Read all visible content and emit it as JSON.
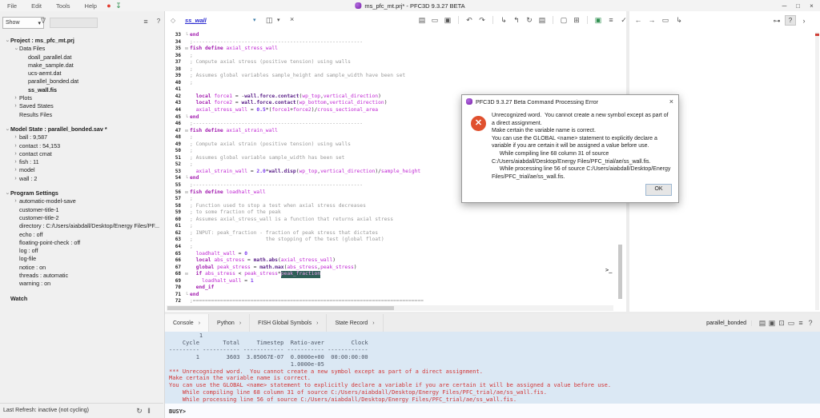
{
  "titlebar": {
    "menus": [
      "File",
      "Edit",
      "Tools",
      "Help"
    ],
    "left_icons": [
      {
        "name": "record-icon",
        "glyph": "●",
        "color": "#e23b2e"
      },
      {
        "name": "download-icon",
        "glyph": "↧",
        "color": "#2f8f4f"
      }
    ],
    "title": "ms_pfc_mt.prj* - PFC3D 9.3.27 BETA",
    "window_buttons": [
      {
        "name": "minimize-button",
        "glyph": "─"
      },
      {
        "name": "maximize-button",
        "glyph": "□"
      },
      {
        "name": "close-button",
        "glyph": "×"
      }
    ]
  },
  "left_panel": {
    "show_label": "Show",
    "combo_caret": "▾",
    "funnel_glyph": "∇",
    "options_glyph": "≡",
    "help_glyph": "?",
    "search_value": "",
    "tree": [
      {
        "t": "Project :  ms_pfc_mt.prj",
        "lv": 0,
        "bold": true,
        "ar": "e"
      },
      {
        "t": "Data Files",
        "lv": 1,
        "ar": "e"
      },
      {
        "t": "doall_parallel.dat",
        "lv": 2
      },
      {
        "t": "make_sample.dat",
        "lv": 2
      },
      {
        "t": "ucs-aemt.dat",
        "lv": 2
      },
      {
        "t": "parallel_bonded.dat",
        "lv": 2
      },
      {
        "t": "ss_wall.fis",
        "lv": 2,
        "bold": true
      },
      {
        "t": "Plots",
        "lv": 1,
        "ar": "c"
      },
      {
        "t": "Saved States",
        "lv": 1,
        "ar": "c"
      },
      {
        "t": "Results Files",
        "lv": 1
      },
      {
        "t": "Model State :  parallel_bonded.sav *",
        "lv": 0,
        "bold": true,
        "ar": "e",
        "gap": true
      },
      {
        "t": "ball :  9,587",
        "lv": 1,
        "ar": "c"
      },
      {
        "t": "contact :  54,153",
        "lv": 1,
        "ar": "c"
      },
      {
        "t": "contact cmat",
        "lv": 1,
        "ar": "c"
      },
      {
        "t": "fish :  11",
        "lv": 1,
        "ar": "c"
      },
      {
        "t": "model",
        "lv": 1,
        "ar": "c"
      },
      {
        "t": "wall :  2",
        "lv": 1,
        "ar": "c"
      },
      {
        "t": "Program Settings",
        "lv": 0,
        "bold": true,
        "ar": "e",
        "gap": true
      },
      {
        "t": "automatic-model-save",
        "lv": 1,
        "ar": "c"
      },
      {
        "t": "customer-title-1",
        "lv": 1
      },
      {
        "t": "customer-title-2",
        "lv": 1
      },
      {
        "t": "directory :  C:/Users/aiabdall/Desktop/Energy Files/PF...",
        "lv": 1
      },
      {
        "t": "echo :  off",
        "lv": 1
      },
      {
        "t": "floating-point-check :  off",
        "lv": 1
      },
      {
        "t": "log :  off",
        "lv": 1
      },
      {
        "t": "log-file",
        "lv": 1
      },
      {
        "t": "notice :  on",
        "lv": 1
      },
      {
        "t": "threads :  automatic",
        "lv": 1
      },
      {
        "t": "warning :  on",
        "lv": 1
      },
      {
        "t": "Watch",
        "lv": 0,
        "bold": true,
        "gap": true
      }
    ],
    "status_text": "Last Refresh: inactive (not cycling)",
    "status_icons": [
      {
        "name": "refresh-icon",
        "glyph": "↻"
      },
      {
        "name": "pause-icon",
        "glyph": "‖"
      }
    ]
  },
  "editor": {
    "nav_glyph": "◇",
    "tab_name": "ss_wall",
    "caret_glyph": "▾",
    "split_glyph": "◫",
    "close_glyph": "×",
    "prompt_badge": ">_",
    "toolbar_icons": [
      {
        "name": "new-file-icon",
        "glyph": "▤"
      },
      {
        "name": "open-file-icon",
        "glyph": "▭"
      },
      {
        "name": "save-file-icon",
        "glyph": "▣"
      },
      {
        "name": "separator"
      },
      {
        "name": "undo-icon",
        "glyph": "↶"
      },
      {
        "name": "redo-icon",
        "glyph": "↷"
      },
      {
        "name": "separator"
      },
      {
        "name": "execute-file-icon",
        "glyph": "↳"
      },
      {
        "name": "execute-selection-icon",
        "glyph": "↰"
      },
      {
        "name": "reload-file-icon",
        "glyph": "↻"
      },
      {
        "name": "edit-document-icon",
        "glyph": "▤"
      },
      {
        "name": "separator"
      },
      {
        "name": "previous-view-icon",
        "glyph": "▢"
      },
      {
        "name": "next-view-icon",
        "glyph": "⊞"
      },
      {
        "name": "separator"
      },
      {
        "name": "export-document-icon",
        "glyph": "▣",
        "color": "#2f8f4f"
      },
      {
        "name": "editor-options-icon",
        "glyph": "≡"
      },
      {
        "name": "syntax-check-icon",
        "glyph": "✓"
      },
      {
        "name": "check-caret-icon",
        "glyph": "▾"
      },
      {
        "name": "editor-help-icon",
        "glyph": "?"
      }
    ],
    "code_lines": [
      {
        "n": 33,
        "fold": "e",
        "segs": [
          [
            "kw",
            "end"
          ]
        ]
      },
      {
        "n": 34,
        "segs": [
          [
            "cm",
            ";--------------------------------------------------------"
          ]
        ]
      },
      {
        "n": 35,
        "fold": "b",
        "segs": [
          [
            "kw",
            "fish define "
          ],
          [
            "var",
            "axial_stress_wall"
          ]
        ]
      },
      {
        "n": 36,
        "segs": [
          [
            "cm",
            ";"
          ]
        ]
      },
      {
        "n": 37,
        "segs": [
          [
            "cm",
            "; Compute axial stress (positive tension) using walls"
          ]
        ]
      },
      {
        "n": 38,
        "segs": [
          [
            "cm",
            ";"
          ]
        ]
      },
      {
        "n": 39,
        "segs": [
          [
            "cm",
            "; Assumes global variables sample_height and sample_width have been set"
          ]
        ]
      },
      {
        "n": 40,
        "segs": [
          [
            "cm",
            ";"
          ]
        ]
      },
      {
        "n": 41,
        "segs": []
      },
      {
        "n": 42,
        "segs": [
          [
            "pl",
            "  "
          ],
          [
            "kw",
            "local "
          ],
          [
            "var",
            "force1"
          ],
          [
            "pl",
            " = -"
          ],
          [
            "fn",
            "wall.force.contact"
          ],
          [
            "pl",
            "("
          ],
          [
            "var",
            "wp_top"
          ],
          [
            "pl",
            ","
          ],
          [
            "var",
            "vertical_direction"
          ],
          [
            "pl",
            ")"
          ]
        ]
      },
      {
        "n": 43,
        "segs": [
          [
            "pl",
            "  "
          ],
          [
            "kw",
            "local "
          ],
          [
            "var",
            "force2"
          ],
          [
            "pl",
            " = "
          ],
          [
            "fn",
            "wall.force.contact"
          ],
          [
            "pl",
            "("
          ],
          [
            "var",
            "wp_bottom"
          ],
          [
            "pl",
            ","
          ],
          [
            "var",
            "vertical_direction"
          ],
          [
            "pl",
            ")"
          ]
        ]
      },
      {
        "n": 44,
        "segs": [
          [
            "pl",
            "  "
          ],
          [
            "var",
            "axial_stress_wall"
          ],
          [
            "pl",
            " = "
          ],
          [
            "num",
            "0.5"
          ],
          [
            "pl",
            "*("
          ],
          [
            "var",
            "force1"
          ],
          [
            "pl",
            "+"
          ],
          [
            "var",
            "force2"
          ],
          [
            "pl",
            ")/"
          ],
          [
            "var",
            "cross_sectional_area"
          ]
        ]
      },
      {
        "n": 45,
        "fold": "e",
        "segs": [
          [
            "kw",
            "end"
          ]
        ]
      },
      {
        "n": 46,
        "segs": [
          [
            "cm",
            ";--------------------------------------------------------"
          ]
        ]
      },
      {
        "n": 47,
        "fold": "b",
        "segs": [
          [
            "kw",
            "fish define "
          ],
          [
            "var",
            "axial_strain_wall"
          ]
        ]
      },
      {
        "n": 48,
        "segs": [
          [
            "cm",
            ";"
          ]
        ]
      },
      {
        "n": 49,
        "segs": [
          [
            "cm",
            "; Compute axial strain (positive tension) using walls"
          ]
        ]
      },
      {
        "n": 50,
        "segs": [
          [
            "cm",
            ";"
          ]
        ]
      },
      {
        "n": 51,
        "segs": [
          [
            "cm",
            "; Assumes global variable sample_width has been set"
          ]
        ]
      },
      {
        "n": 52,
        "segs": [
          [
            "cm",
            ";"
          ]
        ]
      },
      {
        "n": 53,
        "segs": [
          [
            "pl",
            "  "
          ],
          [
            "var",
            "axial_strain_wall"
          ],
          [
            "pl",
            " = "
          ],
          [
            "num",
            "2.0"
          ],
          [
            "pl",
            "*"
          ],
          [
            "fn",
            "wall.disp"
          ],
          [
            "pl",
            "("
          ],
          [
            "var",
            "wp_top"
          ],
          [
            "pl",
            ","
          ],
          [
            "var",
            "vertical_direction"
          ],
          [
            "pl",
            ")/"
          ],
          [
            "var",
            "sample_height"
          ]
        ]
      },
      {
        "n": 54,
        "fold": "e",
        "segs": [
          [
            "kw",
            "end"
          ]
        ]
      },
      {
        "n": 55,
        "segs": [
          [
            "cm",
            ";--------------------------------------------------------"
          ]
        ]
      },
      {
        "n": 56,
        "fold": "b",
        "segs": [
          [
            "kw",
            "fish define "
          ],
          [
            "var",
            "loadhalt_wall"
          ]
        ]
      },
      {
        "n": 57,
        "segs": [
          [
            "cm",
            ";"
          ]
        ]
      },
      {
        "n": 58,
        "segs": [
          [
            "cm",
            "; Function used to stop a test when axial stress decreases"
          ]
        ]
      },
      {
        "n": 59,
        "segs": [
          [
            "cm",
            "; to some fraction of the peak"
          ]
        ]
      },
      {
        "n": 60,
        "segs": [
          [
            "cm",
            "; Assumes axial_stress_wall is a function that returns axial stress"
          ]
        ]
      },
      {
        "n": 61,
        "segs": [
          [
            "cm",
            ";"
          ]
        ]
      },
      {
        "n": 62,
        "segs": [
          [
            "cm",
            "; INPUT: peak_fraction - fraction of peak stress that dictates"
          ]
        ]
      },
      {
        "n": 63,
        "segs": [
          [
            "cm",
            ";                        the stopping of the test (global float)"
          ]
        ]
      },
      {
        "n": 64,
        "segs": [
          [
            "cm",
            ";"
          ]
        ]
      },
      {
        "n": 65,
        "segs": [
          [
            "pl",
            "  "
          ],
          [
            "var",
            "loadhalt_wall"
          ],
          [
            "pl",
            " = "
          ],
          [
            "num",
            "0"
          ]
        ]
      },
      {
        "n": 66,
        "segs": [
          [
            "pl",
            "  "
          ],
          [
            "kw",
            "local "
          ],
          [
            "var",
            "abs_stress"
          ],
          [
            "pl",
            " = "
          ],
          [
            "fn",
            "math.abs"
          ],
          [
            "pl",
            "("
          ],
          [
            "var",
            "axial_stress_wall"
          ],
          [
            "pl",
            ")"
          ]
        ]
      },
      {
        "n": 67,
        "segs": [
          [
            "pl",
            "  "
          ],
          [
            "kw",
            "global "
          ],
          [
            "var",
            "peak_stress"
          ],
          [
            "pl",
            " = "
          ],
          [
            "fn",
            "math.max"
          ],
          [
            "pl",
            "("
          ],
          [
            "var",
            "abs_stress"
          ],
          [
            "pl",
            ","
          ],
          [
            "var",
            "peak_stress"
          ],
          [
            "pl",
            ")"
          ]
        ]
      },
      {
        "n": 68,
        "fold": "b",
        "segs": [
          [
            "pl",
            "  "
          ],
          [
            "kw",
            "if "
          ],
          [
            "var",
            "abs_stress"
          ],
          [
            "pl",
            " < "
          ],
          [
            "var",
            "peak_stress"
          ],
          [
            "pl",
            "*"
          ],
          [
            "sel",
            "peak_fraction"
          ]
        ]
      },
      {
        "n": 69,
        "segs": [
          [
            "pl",
            "    "
          ],
          [
            "var",
            "loadhalt_wall"
          ],
          [
            "pl",
            " = "
          ],
          [
            "num",
            "1"
          ]
        ]
      },
      {
        "n": 70,
        "segs": [
          [
            "pl",
            "  "
          ],
          [
            "kw",
            "end_if"
          ]
        ]
      },
      {
        "n": 71,
        "fold": "e",
        "segs": [
          [
            "kw",
            "end"
          ]
        ]
      },
      {
        "n": 72,
        "segs": [
          [
            "cm",
            ";============================================================================"
          ]
        ]
      }
    ]
  },
  "right_pane": {
    "toolbar_icons": [
      {
        "name": "back-icon",
        "glyph": "←"
      },
      {
        "name": "forward-icon",
        "glyph": "→"
      },
      {
        "name": "new-window-icon",
        "glyph": "▭"
      },
      {
        "name": "execute-icon",
        "glyph": "↳"
      }
    ],
    "pin_glyph": "⊶",
    "help_glyph": "?",
    "expand_glyph": "›"
  },
  "console": {
    "tabs": [
      "Console",
      "Python",
      "FISH Global Symbols",
      "State Record"
    ],
    "tab_chevron": "›",
    "right_label": "parallel_bonded",
    "right_icons": [
      {
        "name": "restore-state-icon",
        "glyph": "▤"
      },
      {
        "name": "save-state-icon",
        "glyph": "▣"
      },
      {
        "name": "copy-output-icon",
        "glyph": "⊡"
      },
      {
        "name": "open-folder-icon",
        "glyph": "▭"
      },
      {
        "name": "console-options-icon",
        "glyph": "≡"
      },
      {
        "name": "console-help-icon",
        "glyph": "?"
      }
    ],
    "output": [
      {
        "c": "n",
        "t": "         1"
      },
      {
        "c": "n",
        "t": "    Cycle       Total     Timestep  Ratio-aver        Clock"
      },
      {
        "c": "n",
        "t": "--------- ----------- ------------ ----------- ------------"
      },
      {
        "c": "n",
        "t": "        1        3603  3.05067E-07  0.0000e+00  00:00:00:00"
      },
      {
        "c": "n",
        "t": "                                    1.0000e-05"
      },
      {
        "c": "e",
        "t": "*** Unrecognized word.  You cannot create a new symbol except as part of a direct assignment."
      },
      {
        "c": "e",
        "t": "Make certain the variable name is correct."
      },
      {
        "c": "e",
        "t": "You can use the GLOBAL <name> statement to explicitly declare a variable if you are certain it will be assigned a value before use."
      },
      {
        "c": "e",
        "t": "    While compiling line 68 column 31 of source C:/Users/aiabdall/Desktop/Energy Files/PFC_trial/ae/ss_wall.fis."
      },
      {
        "c": "e",
        "t": "    While processing line 56 of source C:/Users/aiabdall/Desktop/Energy Files/PFC_trial/ae/ss_wall.fis."
      }
    ],
    "prompt": "BUSY>"
  },
  "dialog": {
    "title": "PFC3D 9.3.27 Beta Command Processing Error",
    "close_glyph": "×",
    "error_glyph": "✕",
    "message_lines": [
      "Unrecognized word.  You cannot create a new symbol except as part of a direct assignment.",
      "Make certain the variable name is correct.",
      "You can use the GLOBAL <name> statement to explicitly declare a variable if you are certain it will be assigned a value before use.",
      "     While compiling line 68 column 31 of source C:/Users/aiabdall/Desktop/Energy Files/PFC_trial/ae/ss_wall.fis.",
      "     While processing line 56 of source C:/Users/aiabdall/Desktop/Energy Files/PFC_trial/ae/ss_wall.fis."
    ],
    "ok_label": "OK"
  }
}
